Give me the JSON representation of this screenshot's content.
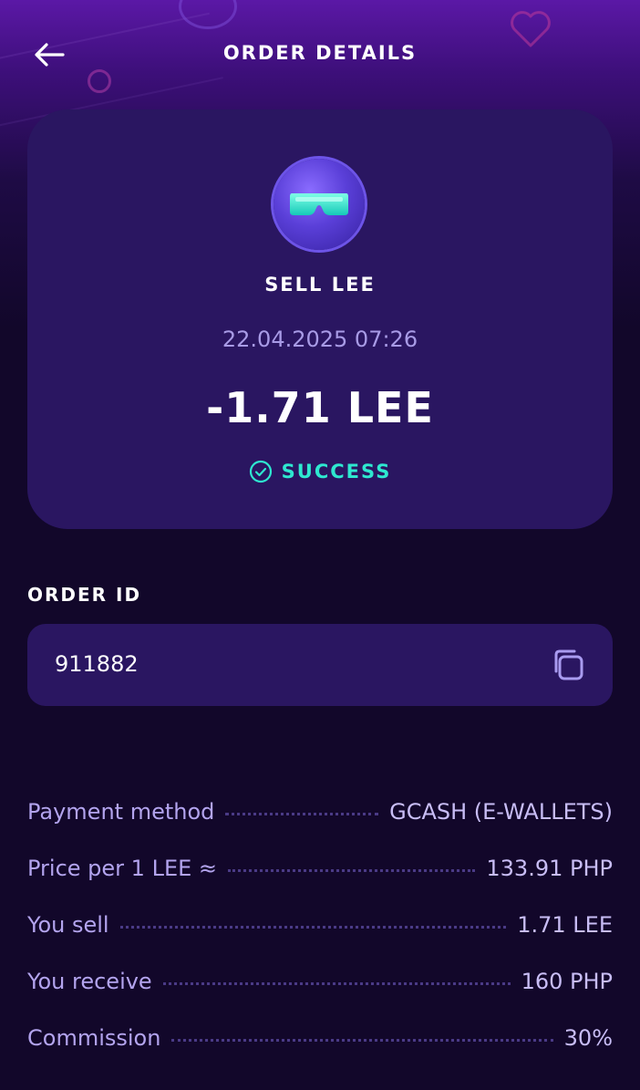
{
  "header": {
    "title": "ORDER DETAILS",
    "back_icon": "arrow-left-icon"
  },
  "summary": {
    "type_label": "SELL LEE",
    "date": "22.04.2025 07:26",
    "amount": "-1.71 LEE",
    "status": "SUCCESS",
    "status_color": "#2ee8d0"
  },
  "order": {
    "id_label": "ORDER ID",
    "id_value": "911882",
    "copy_icon": "copy-icon"
  },
  "details": [
    {
      "label": "Payment method",
      "value": "GCASH (E-WALLETS)"
    },
    {
      "label": "Price per 1 LEE ≈",
      "value": "133.91 PHP"
    },
    {
      "label": "You sell",
      "value": "1.71 LEE"
    },
    {
      "label": "You receive",
      "value": "160 PHP"
    },
    {
      "label": "Commission",
      "value": "30%"
    }
  ],
  "colors": {
    "background": "#12072a",
    "card": "#2a1661",
    "muted_text": "#a89be6",
    "accent": "#2ee8d0"
  }
}
